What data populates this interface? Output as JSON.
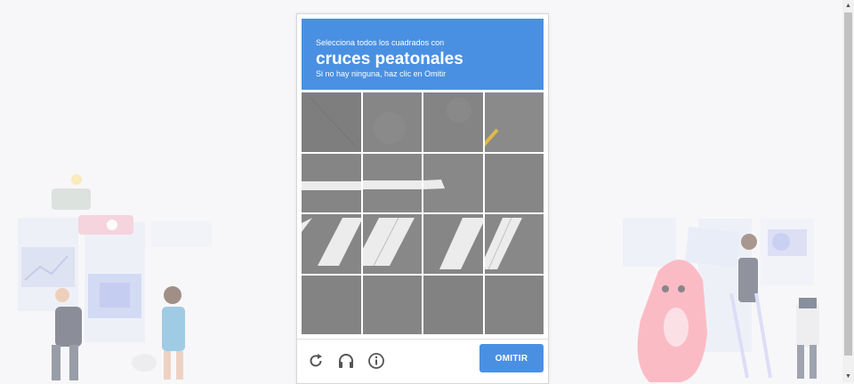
{
  "challenge": {
    "instruction_line1": "Selecciona todos los cuadrados con",
    "target_object": "cruces peatonales",
    "instruction_line3": "Si no hay ninguna, haz clic en Omitir"
  },
  "grid": {
    "rows": 4,
    "cols": 4,
    "tiles": [
      "tile-r1c1",
      "tile-r1c2",
      "tile-r1c3",
      "tile-r1c4",
      "tile-r2c1",
      "tile-r2c2",
      "tile-r2c3",
      "tile-r2c4",
      "tile-r3c1",
      "tile-r3c2",
      "tile-r3c3",
      "tile-r3c4",
      "tile-r4c1",
      "tile-r4c2",
      "tile-r4c3",
      "tile-r4c4"
    ]
  },
  "footer": {
    "reload_icon": "reload-icon",
    "audio_icon": "headphones-icon",
    "info_icon": "info-icon",
    "skip_label": "OMITIR"
  },
  "colors": {
    "accent": "#4a90e2",
    "road": "#858585",
    "paint": "#eeeeee"
  }
}
